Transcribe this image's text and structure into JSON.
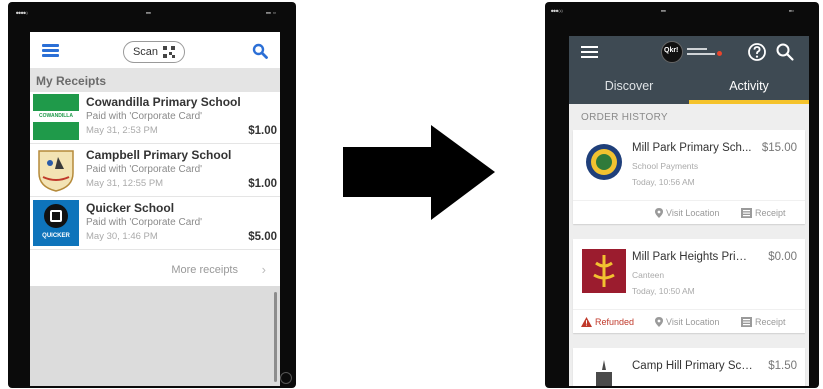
{
  "left_screen": {
    "scan_label": "Scan",
    "header": "My Receipts",
    "receipts": [
      {
        "name": "Cowandilla Primary School",
        "paid_with": "Paid with 'Corporate Card'",
        "date": "May 31, 2:53 PM",
        "amount": "$1.00",
        "logo_text": "COWANDILLA"
      },
      {
        "name": "Campbell Primary School",
        "paid_with": "Paid with 'Corporate Card'",
        "date": "May 31, 12:55 PM",
        "amount": "$1.00"
      },
      {
        "name": "Quicker School",
        "paid_with": "Paid with 'Corporate Card'",
        "date": "May 30, 1:46 PM",
        "amount": "$5.00",
        "logo_text": "QUICKER"
      }
    ],
    "more_label": "More receipts",
    "icons": {
      "menu": "hamburger-icon",
      "search": "search-icon",
      "qr": "qr-code-icon",
      "chevron": "chevron-right-icon"
    },
    "colors": {
      "accent": "#2b6fd6",
      "header_bg": "#e4e4e4"
    }
  },
  "right_screen": {
    "logo_text": "Qkr!",
    "tabs": [
      {
        "label": "Discover"
      },
      {
        "label": "Activity"
      }
    ],
    "active_tab": "Activity",
    "section": "ORDER HISTORY",
    "orders": [
      {
        "name": "Mill Park Primary Sch...",
        "amount": "$15.00",
        "category": "School Payments",
        "time": "Today, 10:56 AM",
        "visit": "Visit Location",
        "receipt": "Receipt"
      },
      {
        "name": "Mill Park Heights Prim...",
        "amount": "$0.00",
        "category": "Canteen",
        "time": "Today, 10:50 AM",
        "refunded": "Refunded",
        "visit": "Visit Location",
        "receipt": "Receipt"
      },
      {
        "name": "Camp Hill Primary Sch...",
        "amount": "$1.50"
      }
    ],
    "icons": {
      "menu": "hamburger-icon",
      "help": "help-icon",
      "search": "search-icon",
      "pin": "location-pin-icon",
      "receipt": "receipt-icon",
      "warning": "warning-icon"
    },
    "colors": {
      "appbar": "#3e4a53",
      "tab_indicator": "#f5c32b",
      "refund": "#c0392b"
    }
  }
}
